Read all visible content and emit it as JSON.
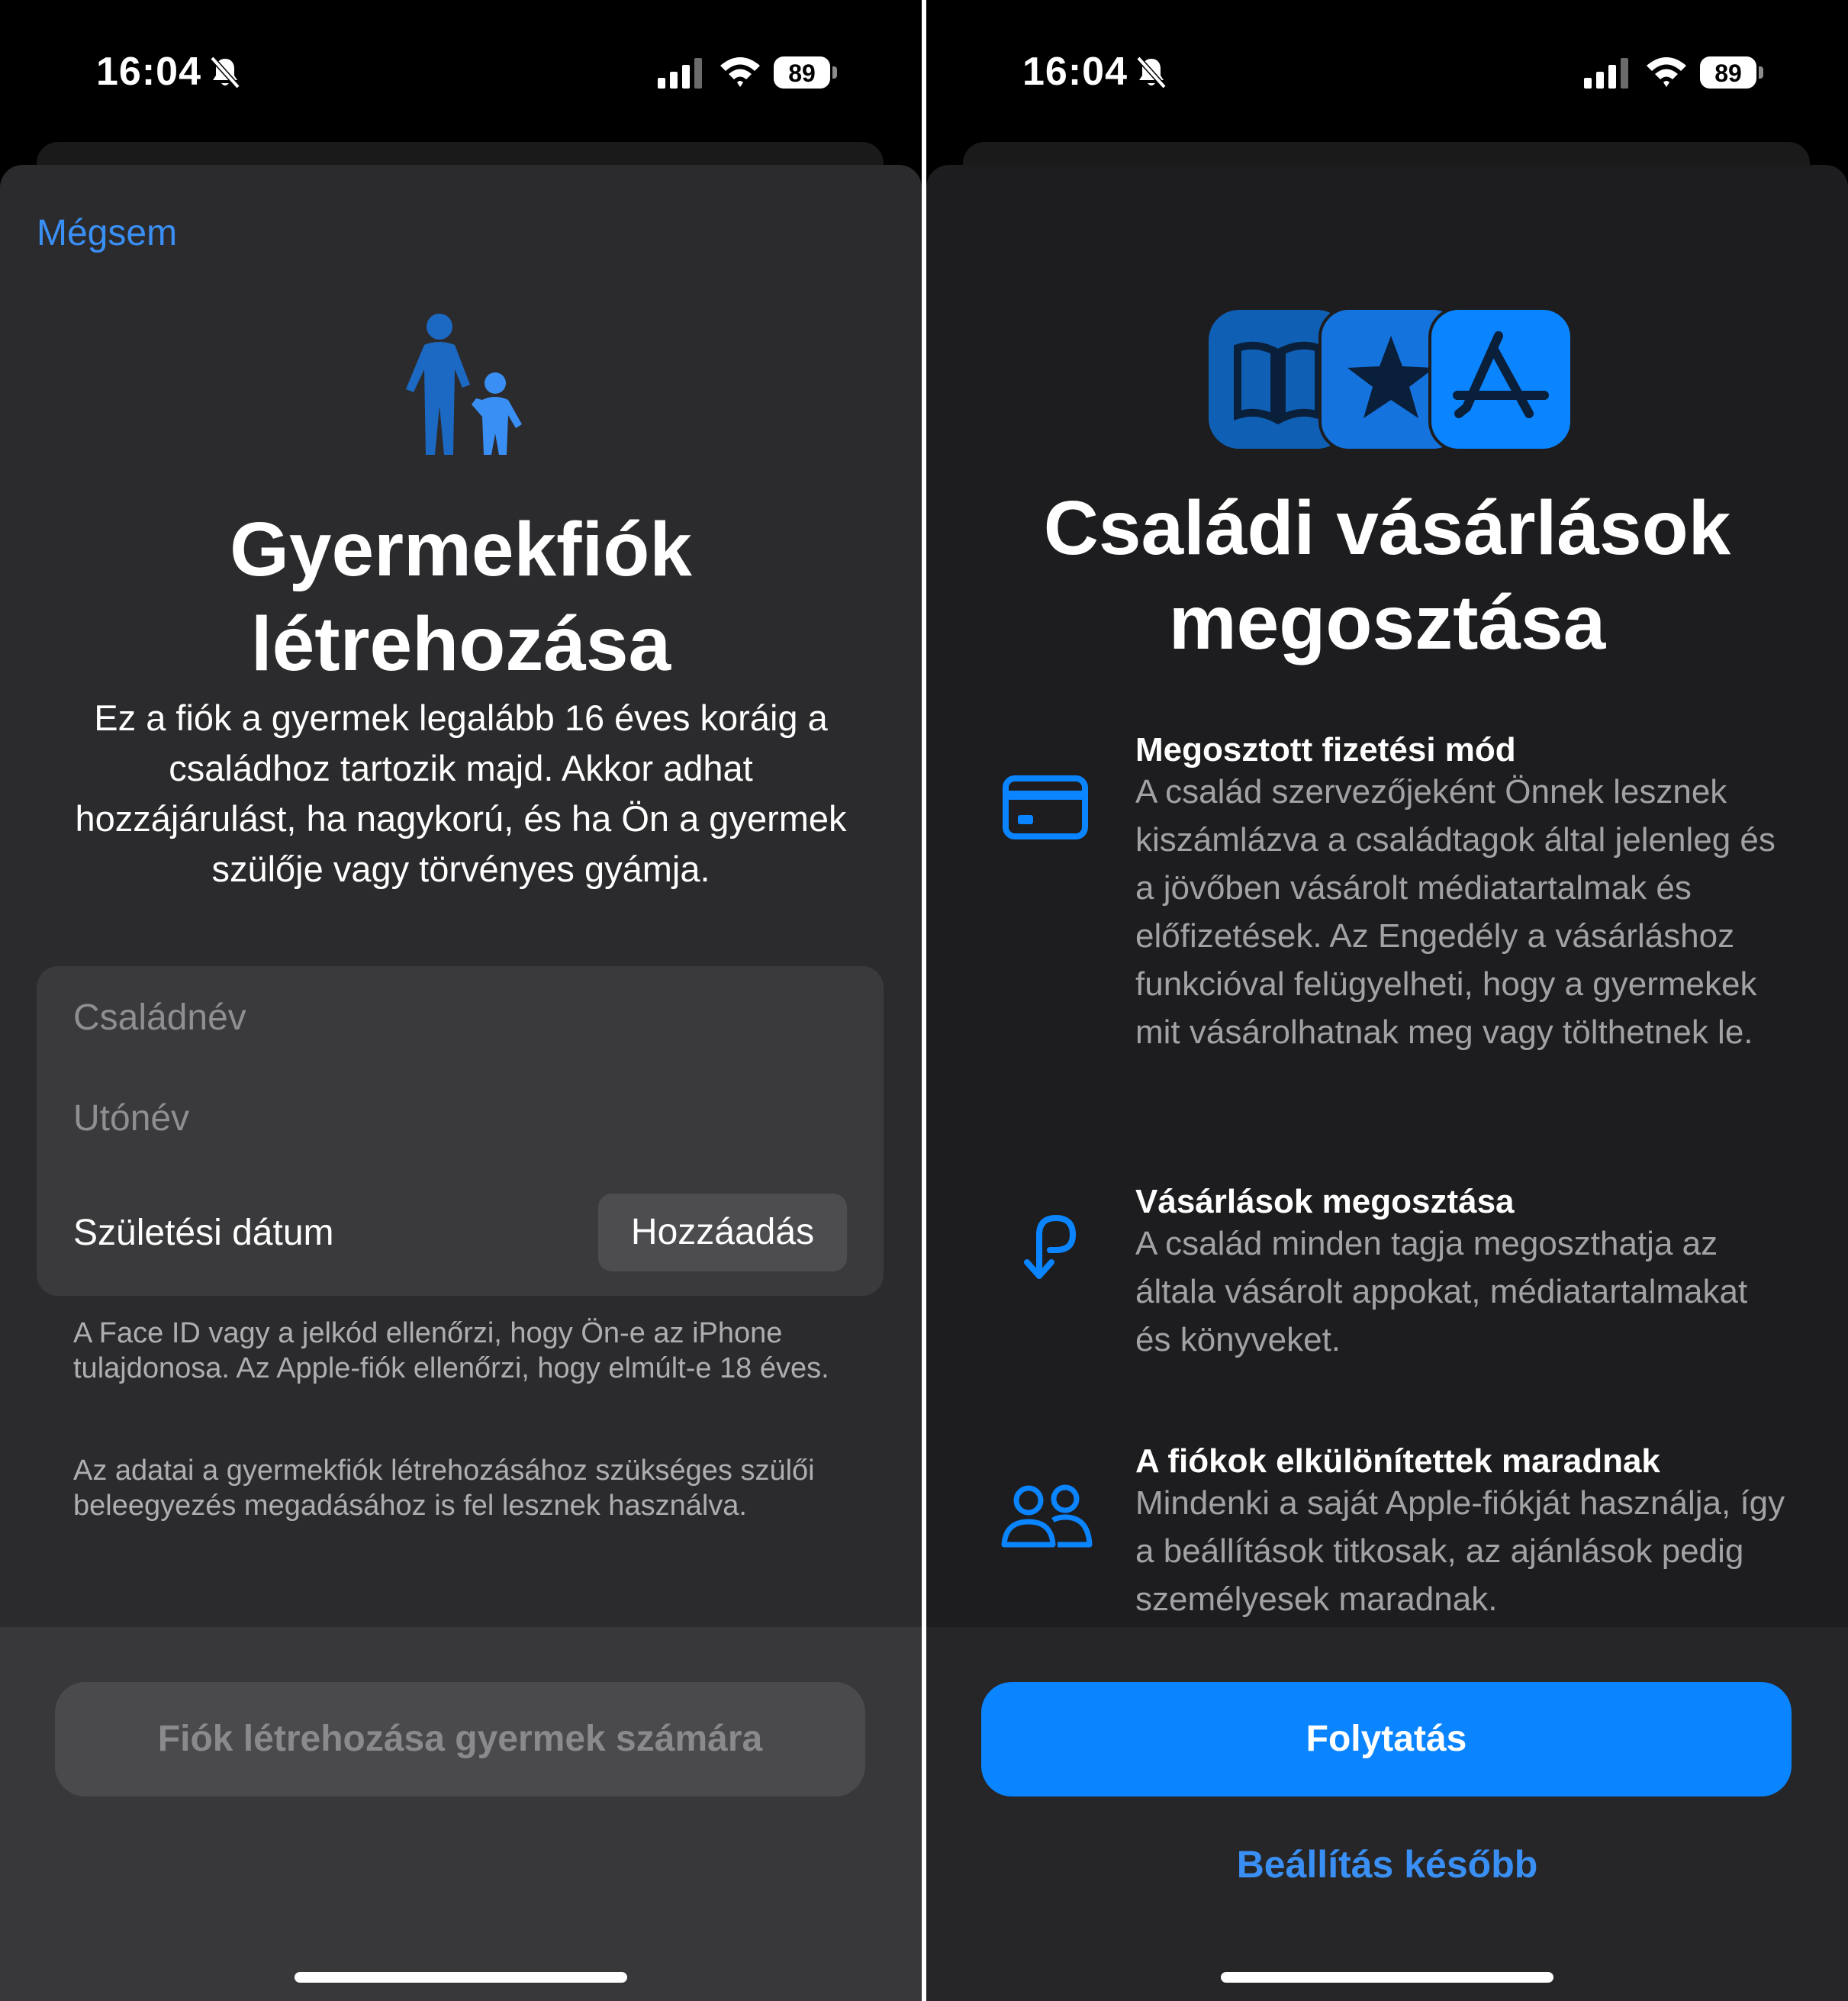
{
  "status_bar": {
    "time": "16:04",
    "battery": "89"
  },
  "left_screen": {
    "cancel_label": "Mégsem",
    "title_line1": "Gyermekfiók",
    "title_line2": "létrehozása",
    "description": "Ez a fiók a gyermek legalább 16 éves koráig a családhoz tartozik majd. Akkor adhat hozzájárulást, ha nagykorú, és ha Ön a gyermek szülője vagy törvényes gyámja.",
    "form": {
      "last_name_placeholder": "Családnév",
      "first_name_placeholder": "Utónév",
      "birthdate_label": "Születési dátum",
      "add_button": "Hozzáadás"
    },
    "note1": "A Face ID vagy a jelkód ellenőrzi, hogy Ön-e az iPhone tulajdonosa. Az Apple-fiók ellenőrzi, hogy elmúlt-e 18 éves.",
    "note2": "Az adatai a gyermekfiók létrehozásához szükséges szülői beleegyezés megadásához is fel lesznek használva.",
    "create_button": "Fiók létrehozása gyermek számára"
  },
  "right_screen": {
    "title_line1": "Családi vásárlások",
    "title_line2": "megosztása",
    "features": [
      {
        "icon": "credit-card-icon",
        "title": "Megosztott fizetési mód",
        "text": "A család szervezőjeként Önnek lesznek kiszámlázva a családtagok által jelenleg és a jövőben vásárolt médiatartalmak és előfizetések. Az Engedély a vásárláshoz funkcióval felügyelheti, hogy a gyermekek mit vásárolhatnak meg vagy tölthetnek le."
      },
      {
        "icon": "share-purchases-icon",
        "title": "Vásárlások megosztása",
        "text": "A család minden tagja megoszthatja az általa vásárolt appokat, médiatartalmakat és könyveket."
      },
      {
        "icon": "two-people-icon",
        "title": "A fiókok elkülönítettek maradnak",
        "text": "Mindenki a saját Apple-fiókját használja, így a beállítások titkosak, az ajánlások pedig személyesek maradnak."
      }
    ],
    "continue_button": "Folytatás",
    "later_button": "Beállítás később"
  },
  "colors": {
    "accent": "#0a84ff",
    "link": "#3a8ff5",
    "sheet": "#2b2b2d"
  }
}
